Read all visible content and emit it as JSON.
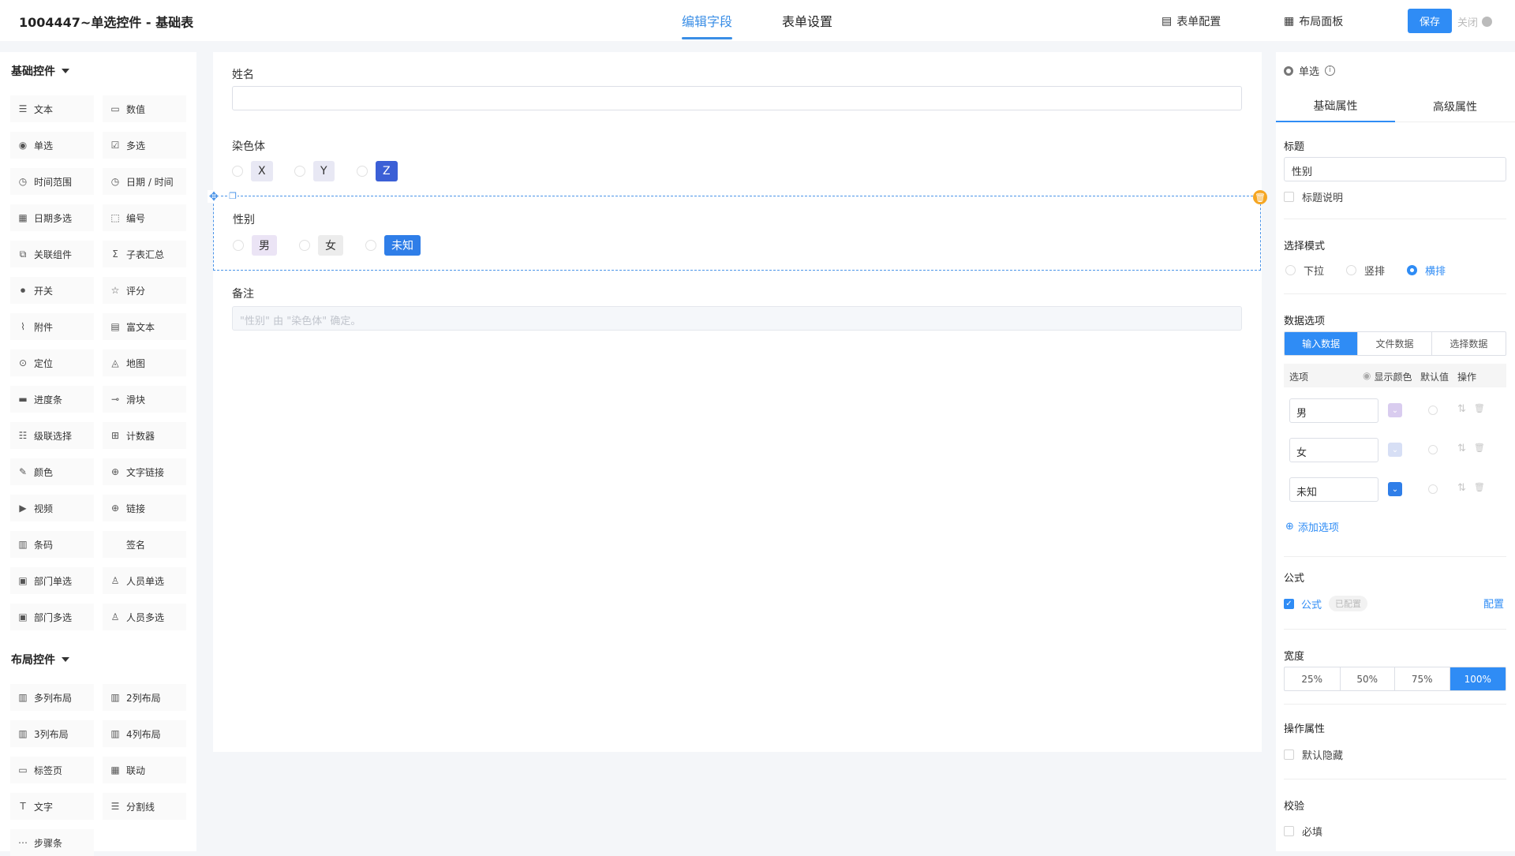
{
  "header": {
    "title": "1004447~单选控件 - 基础表",
    "tabs": [
      "编辑字段",
      "表单设置"
    ],
    "form_config": "表单配置",
    "layout_panel": "布局面板",
    "save": "保存",
    "close": "关闭"
  },
  "left": {
    "basic_title": "基础控件",
    "basic": [
      {
        "label": "文本",
        "icon": "text-icon"
      },
      {
        "label": "数值",
        "icon": "number-icon"
      },
      {
        "label": "单选",
        "icon": "radio-icon"
      },
      {
        "label": "多选",
        "icon": "checkbox-icon"
      },
      {
        "label": "时间范围",
        "icon": "clock-icon"
      },
      {
        "label": "日期 / 时间",
        "icon": "clock-icon"
      },
      {
        "label": "日期多选",
        "icon": "calendar-icon"
      },
      {
        "label": "编号",
        "icon": "serial-icon"
      },
      {
        "label": "关联组件",
        "icon": "link-component-icon"
      },
      {
        "label": "子表汇总",
        "icon": "sigma-icon"
      },
      {
        "label": "开关",
        "icon": "toggle-icon"
      },
      {
        "label": "评分",
        "icon": "star-icon"
      },
      {
        "label": "附件",
        "icon": "paperclip-icon"
      },
      {
        "label": "富文本",
        "icon": "richtext-icon"
      },
      {
        "label": "定位",
        "icon": "location-icon"
      },
      {
        "label": "地图",
        "icon": "map-icon"
      },
      {
        "label": "进度条",
        "icon": "progress-icon"
      },
      {
        "label": "滑块",
        "icon": "slider-icon"
      },
      {
        "label": "级联选择",
        "icon": "cascade-icon"
      },
      {
        "label": "计数器",
        "icon": "counter-icon"
      },
      {
        "label": "颜色",
        "icon": "pen-icon"
      },
      {
        "label": "文字链接",
        "icon": "globe-icon"
      },
      {
        "label": "视频",
        "icon": "video-icon"
      },
      {
        "label": "链接",
        "icon": "globe-icon"
      },
      {
        "label": "条码",
        "icon": "barcode-icon"
      },
      {
        "label": "签名",
        "icon": ""
      },
      {
        "label": "部门单选",
        "icon": "department-icon"
      },
      {
        "label": "人员单选",
        "icon": "user-icon"
      },
      {
        "label": "部门多选",
        "icon": "departments-icon"
      },
      {
        "label": "人员多选",
        "icon": "users-icon"
      }
    ],
    "layout_title": "布局控件",
    "layout": [
      {
        "label": "多列布局",
        "icon": "columns-icon"
      },
      {
        "label": "2列布局",
        "icon": "columns-icon"
      },
      {
        "label": "3列布局",
        "icon": "columns-icon"
      },
      {
        "label": "4列布局",
        "icon": "columns-icon"
      },
      {
        "label": "标签页",
        "icon": "tabs-icon"
      },
      {
        "label": "联动",
        "icon": "grid-icon"
      },
      {
        "label": "文字",
        "icon": "text-t-icon"
      },
      {
        "label": "分割线",
        "icon": "divider-icon"
      },
      {
        "label": "步骤条",
        "icon": "steps-icon"
      }
    ]
  },
  "canvas": {
    "name_label": "姓名",
    "chromosome_label": "染色体",
    "chromosome_options": [
      {
        "label": "X",
        "color": "#e8e8f4"
      },
      {
        "label": "Y",
        "color": "#e8e8f4"
      },
      {
        "label": "Z",
        "color": "#3b5fd6"
      }
    ],
    "gender_label": "性别",
    "gender_options": [
      {
        "label": "男",
        "color": "#ebe4f5"
      },
      {
        "label": "女",
        "color": "#ececec"
      },
      {
        "label": "未知",
        "color": "#2f7ee8"
      }
    ],
    "remark_label": "备注",
    "remark_value": "\"性别\" 由 \"染色体\" 确定。"
  },
  "right": {
    "control_type": "单选",
    "tabs": [
      "基础属性",
      "高级属性"
    ],
    "title_label": "标题",
    "title_value": "性别",
    "title_desc": "标题说明",
    "mode_label": "选择模式",
    "modes": [
      "下拉",
      "竖排",
      "横排"
    ],
    "data_options_label": "数据选项",
    "data_sources": [
      "输入数据",
      "文件数据",
      "选择数据"
    ],
    "table_headers": {
      "option": "选项",
      "show_color": "显示颜色",
      "default": "默认值",
      "action": "操作"
    },
    "options": [
      {
        "label": "男",
        "color": "#d9ccef"
      },
      {
        "label": "女",
        "color": "#d7dff5"
      },
      {
        "label": "未知",
        "color": "#2f7ee8"
      }
    ],
    "add_option": "添加选项",
    "formula_label": "公式",
    "formula_check": "公式",
    "formula_status": "已配置",
    "formula_config": "配置",
    "width_label": "宽度",
    "widths": [
      "25%",
      "50%",
      "75%",
      "100%"
    ],
    "op_label": "操作属性",
    "default_hidden": "默认隐藏",
    "validate_label": "校验",
    "required": "必填"
  }
}
